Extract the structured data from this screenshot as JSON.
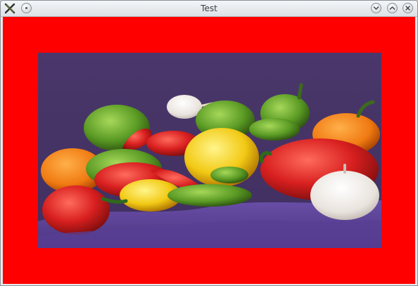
{
  "window": {
    "title": "Test",
    "buttons": [
      "window-menu",
      "minimize",
      "maximize",
      "close"
    ]
  },
  "content": {
    "background_color": "#ff0000",
    "image_subject": "peppers"
  },
  "icons": {
    "app": "x-app-icon",
    "menu": "circle-menu-icon",
    "minimize": "chevron-down-icon",
    "maximize": "chevron-up-icon",
    "close": "close-x-icon"
  }
}
